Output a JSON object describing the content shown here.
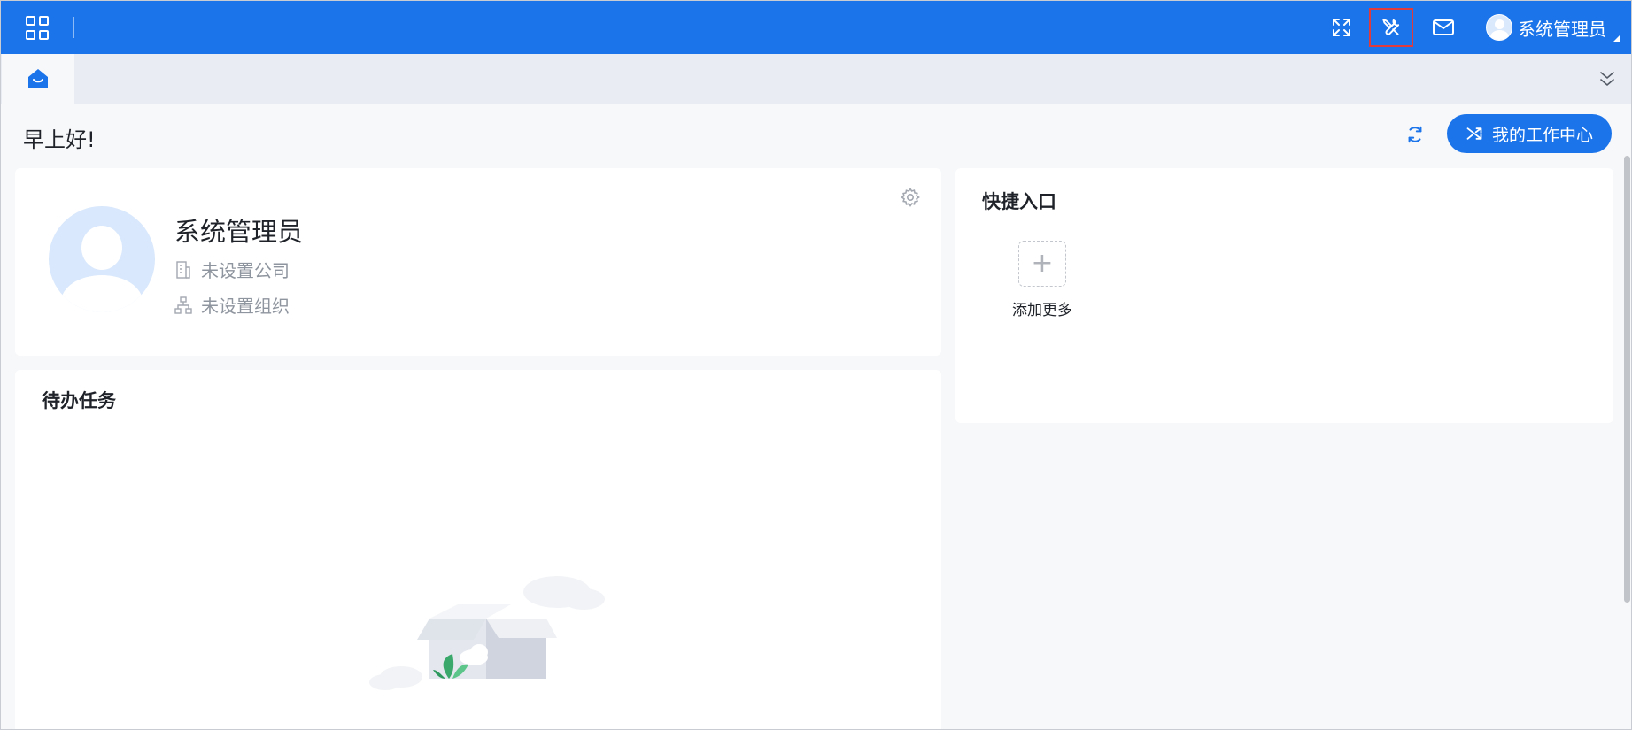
{
  "header": {
    "user_name": "系统管理员",
    "colors": {
      "bar": "#1b74ea",
      "highlight_border": "#e23b3b"
    },
    "icons": [
      "apps-grid-icon",
      "fullscreen-icon",
      "tools-icon",
      "mail-icon",
      "user-avatar-icon"
    ]
  },
  "tabs": {
    "home_icon": "home-icon",
    "collapse_icon": "double-chevron-down-icon"
  },
  "greeting": {
    "text": "早上好!",
    "refresh_icon": "refresh-icon",
    "work_center_label": "我的工作中心",
    "work_center_icon": "shuffle-icon"
  },
  "profile": {
    "name": "系统管理员",
    "company": "未设置公司",
    "organization": "未设置组织",
    "settings_icon": "gear-icon"
  },
  "quick_entry": {
    "title": "快捷入口",
    "add_more_label": "添加更多"
  },
  "todo": {
    "title": "待办任务",
    "empty_illustration": "empty-box-illustration"
  }
}
